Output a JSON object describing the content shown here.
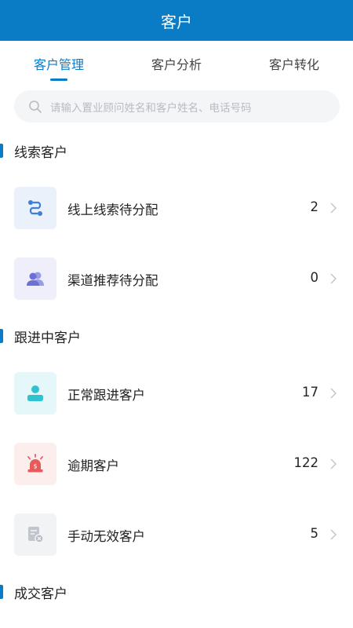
{
  "header": {
    "title": "客户"
  },
  "tabs": [
    {
      "label": "客户管理",
      "active": true
    },
    {
      "label": "客户分析",
      "active": false
    },
    {
      "label": "客户转化",
      "active": false
    }
  ],
  "search": {
    "placeholder": "请输入置业顾问姓名和客户姓名、电话号码",
    "icon": "search-icon"
  },
  "sections": [
    {
      "title": "线索客户",
      "items": [
        {
          "label": "线上线索待分配",
          "count": "2",
          "icon": "route-icon",
          "icon_bg": "#eaf1fb",
          "icon_color": "#3f7fd8"
        },
        {
          "label": "渠道推荐待分配",
          "count": "0",
          "icon": "users-icon",
          "icon_bg": "#eeeffb",
          "icon_color": "#6d6fd6"
        }
      ]
    },
    {
      "title": "跟进中客户",
      "items": [
        {
          "label": "正常跟进客户",
          "count": "17",
          "icon": "person-icon",
          "icon_bg": "#e5f7f9",
          "icon_color": "#2fc2d1"
        },
        {
          "label": "逾期客户",
          "count": "122",
          "icon": "alarm-icon",
          "icon_bg": "#fdeeee",
          "icon_color": "#e85b5b"
        },
        {
          "label": "手动无效客户",
          "count": "5",
          "icon": "invalid-doc-icon",
          "icon_bg": "#f2f3f5",
          "icon_color": "#b6bac0"
        }
      ]
    },
    {
      "title": "成交客户",
      "items": []
    }
  ]
}
